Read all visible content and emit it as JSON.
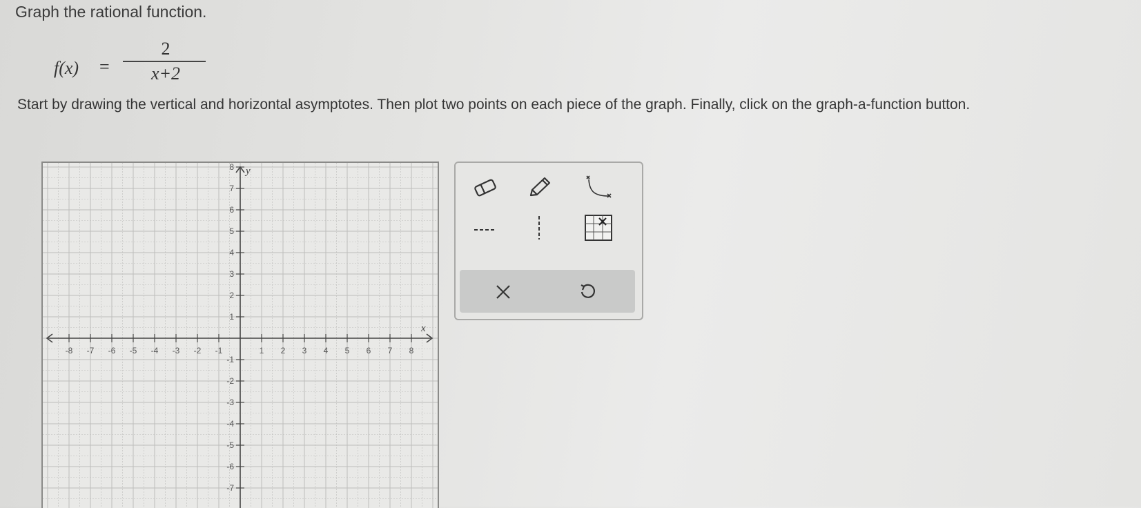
{
  "question": {
    "title": "Graph the rational function.",
    "function_lhs": "f(x)",
    "equals": "=",
    "numerator": "2",
    "denominator": "x+2",
    "instructions": "Start by drawing the vertical and horizontal asymptotes. Then plot two points on each piece of the graph. Finally, click on the graph-a-function button."
  },
  "graph": {
    "x_label": "x",
    "y_label": "y",
    "x_ticks": [
      "-8",
      "-7",
      "-6",
      "-5",
      "-4",
      "-3",
      "-2",
      "-1",
      "1",
      "2",
      "3",
      "4",
      "5",
      "6",
      "7",
      "8"
    ],
    "y_ticks": [
      "8",
      "7",
      "6",
      "5",
      "4",
      "3",
      "2",
      "1",
      "-1",
      "-2",
      "-3",
      "-4",
      "-5",
      "-6",
      "-7"
    ]
  },
  "tools": {
    "eraser": "eraser-icon",
    "pencil": "pencil-icon",
    "graph_function": "graph-function-icon",
    "dashed_horizontal": "dashed-horizontal-line-icon",
    "dashed_vertical": "dashed-vertical-line-icon",
    "point_grid": "grid-point-icon",
    "clear": "x-icon",
    "undo": "undo-icon"
  }
}
